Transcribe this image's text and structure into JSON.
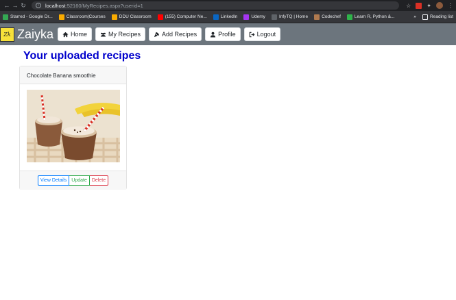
{
  "browser": {
    "url_host": "localhost",
    "url_path": ":52160/MyRecipes.aspx?userid=1",
    "info_icon": "info-icon",
    "bookmarks": [
      {
        "label": "Starred - Google Dr...",
        "color": "#34a853"
      },
      {
        "label": "Classroom|Courses",
        "color": "#f9ab00"
      },
      {
        "label": "DDU Classroom",
        "color": "#f9ab00"
      },
      {
        "label": "(155) Computer Ne...",
        "color": "#ff0000"
      },
      {
        "label": "LinkedIn",
        "color": "#0a66c2"
      },
      {
        "label": "Udemy",
        "color": "#a435f0"
      },
      {
        "label": "InfyTQ | Home",
        "color": "#5f6368"
      },
      {
        "label": "Codechef",
        "color": "#b07a4f"
      },
      {
        "label": "Learn R, Python &...",
        "color": "#2fb34a"
      }
    ],
    "bookmarks_more": "»",
    "reading_list": "Reading list"
  },
  "navbar": {
    "logo_text": "Zk",
    "brand": "Zaiyka",
    "buttons": [
      {
        "label": "Home",
        "icon": "home-icon"
      },
      {
        "label": "My Recipes",
        "icon": "users-icon"
      },
      {
        "label": "Add Recipes",
        "icon": "pizza-icon"
      },
      {
        "label": "Profile",
        "icon": "user-icon"
      },
      {
        "label": "Logout",
        "icon": "logout-icon"
      }
    ]
  },
  "main": {
    "title": "Your uploaded recipes",
    "recipes": [
      {
        "name": "Chocolate Banana smoothie",
        "actions": {
          "view": "View Details",
          "update": "Update",
          "delete": "Delete"
        }
      }
    ]
  },
  "colors": {
    "navbar_bg": "#6c757d",
    "title": "#0000cc",
    "view": "#007bff",
    "update": "#28a745",
    "delete": "#dc3545"
  }
}
